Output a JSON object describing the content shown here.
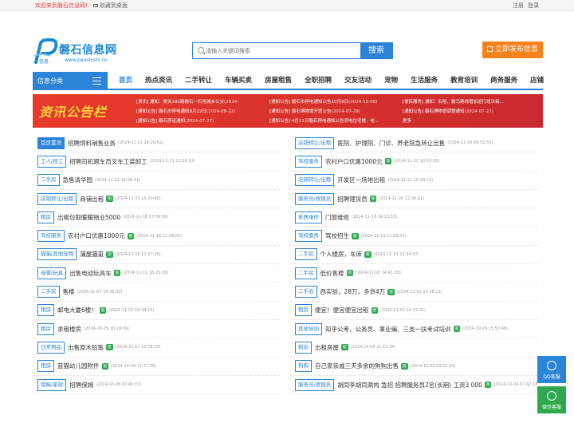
{
  "topbar": {
    "welcome": "欢迎来到磐石信息网!",
    "fav": "收藏到桌面",
    "register": "注册",
    "login": "登录"
  },
  "logo": {
    "name": "磐石信息网",
    "sub": "信息",
    "url": "www.panshishi.cn"
  },
  "search": {
    "placeholder": "请输入关键词搜索",
    "button": "搜索"
  },
  "post_button": "立即发布信息",
  "nav": {
    "category": "信息分类",
    "items": [
      "首页",
      "热点资讯",
      "二手转让",
      "车辆买卖",
      "房屋租售",
      "全职招聘",
      "交友活动",
      "宠物",
      "生活服务",
      "教育培训",
      "商务服务",
      "店铺"
    ]
  },
  "banner": {
    "title": "资讯公告栏",
    "rows": [
      [
        {
          "t": "[资讯] 通知：渠关182路磐石一石咀城乡公交",
          "d": "(2024-"
        },
        {
          "t": "[通知公告] 磐石市停电通知公告10月9日",
          "d": "(2024-10-08)"
        },
        {
          "t": "[便民服务] 通知：石咀、磐马路线增加运行班次每...",
          "d": ""
        }
      ],
      [
        {
          "t": "[通知公告] 磐石市停电通知8月22日",
          "d": "(2024-08-22)"
        },
        {
          "t": "[通知公告] 磐石博物馆开馆公告",
          "d": "(2024-07-29)"
        },
        {
          "t": "[通知公告] 磐石博物馆调馆通知",
          "d": "(2024-07-27)"
        }
      ],
      [
        {
          "t": "[通知公告] 磐石停运通知",
          "d": "(2024-07-27)"
        },
        {
          "t": "[通知公告] 4月11日磐石停电通知公告农电住宅楼、老...",
          "d": ""
        },
        {
          "t": "更多",
          "d": ""
        }
      ]
    ]
  },
  "left_list": [
    {
      "tag": "首页置顶",
      "title": "招聘饲料销售业务",
      "badge": false,
      "date": "(2024-11-17 16:20:52)"
    },
    {
      "tag": "工人/技工",
      "title": "招聘司机跟车员叉车工装卸工",
      "badge": false,
      "date": "(2024-11-23 12:58:12)"
    },
    {
      "tag": "二手房",
      "title": "急售清华园",
      "badge": false,
      "date": "(2024-11-21 15:38:41)"
    },
    {
      "tag": "店铺转让/出租",
      "title": "商铺出租",
      "badge": true,
      "date": "(2024-11-21 15:20:40)"
    },
    {
      "tag": "租房",
      "title": "出租包取暖暖物业5000",
      "badge": false,
      "date": "(2024-11-18 17:09:09)"
    },
    {
      "tag": "驾校服务",
      "title": "农村户口优惠1000元",
      "badge": true,
      "date": "(2024-11-18 12:28:06)"
    },
    {
      "tag": "猫猫/其他宠物",
      "title": "蒲屋猫崽",
      "badge": true,
      "date": "(2024-11-18 11:57:35)"
    },
    {
      "tag": "母婴/玩具",
      "title": "出售电动玩具车",
      "badge": true,
      "date": "(2024-11-11 16:25:26)"
    },
    {
      "tag": "二手房",
      "title": "售楼",
      "badge": false,
      "date": "(2024-11-07 14:36:03)"
    },
    {
      "tag": "租房",
      "title": "邮电大厦6楼！",
      "badge": true,
      "date": "(2024-11-02 14:34:16)"
    },
    {
      "tag": "租房",
      "title": "求租楼房",
      "badge": false,
      "date": "(2024-10-29 18:19:09)"
    },
    {
      "tag": "日常用品",
      "title": "出售原木铅笔",
      "badge": true,
      "date": "(2024-10-11 12:58:20)"
    },
    {
      "tag": "租房",
      "title": "蓝猫幼儿园附件",
      "badge": true,
      "date": "(2024-10-09 11:37:05)"
    },
    {
      "tag": "保姆/家政",
      "title": "招聘保姆",
      "badge": false,
      "date": "(2024-10-08 10:40:07)"
    }
  ],
  "right_list": [
    {
      "tag": "店铺转让/出租",
      "title": "医院、护理院、门诊、养老院急转让出售",
      "badge": false,
      "date": "(2024-11-24 09:53:56)"
    },
    {
      "tag": "驾校服务",
      "title": "农村户口优惠1000元",
      "badge": true,
      "date": "(2024-11-22 10:53:35)"
    },
    {
      "tag": "店铺转让/出租",
      "title": "开发区一场地出租",
      "badge": false,
      "date": "(2024-11-21 15:24:13)"
    },
    {
      "tag": "服务员/收银员",
      "title": "招聘理货员",
      "badge": true,
      "date": "(2024-11-20 12:06:21)"
    },
    {
      "tag": "家居维修",
      "title": "门窗维修",
      "badge": false,
      "date": "(2024-11-18 14:13:53)"
    },
    {
      "tag": "驾校服务",
      "title": "驾校招生",
      "badge": true,
      "date": "(2024-11-18 12:09:53)"
    },
    {
      "tag": "二手房",
      "title": "个人楼房，车库",
      "badge": true,
      "date": "(2024-11-15 21:34:02)"
    },
    {
      "tag": "二手房",
      "title": "低价售楼",
      "badge": true,
      "date": "(2024-11-07 14:41:20)"
    },
    {
      "tag": "二手房",
      "title": "西实验，28万，多贷4万",
      "badge": true,
      "date": "(2024-11-02 14:38:21)"
    },
    {
      "tag": "租房",
      "title": "便宜！便宜便宜出租",
      "badge": true,
      "date": "(2024-11-02 14:29:01)"
    },
    {
      "tag": "其他培训",
      "title": "知乎公考，公务员、事业编、三支一扶考试培训",
      "badge": true,
      "date": "(2024-10-29 15:50:48)"
    },
    {
      "tag": "租房",
      "title": "出租房屋",
      "badge": true,
      "date": "(2024-10-09 22:11:35)"
    },
    {
      "tag": "狗狗",
      "title": "自己家亲戚三天多余的狗狗出售",
      "badge": true,
      "date": "(2024-10-09 09:55:33)"
    },
    {
      "tag": "服务员/收银员",
      "title": "胡同李胡同涮肉 急招 招聘服务员2名(长期) 工资3 000",
      "badge": true,
      "date": "(2024-10-04 07:42:18)"
    }
  ],
  "side": {
    "qq": "QQ客服",
    "wechat": "微信客服"
  },
  "badge_text": "图"
}
